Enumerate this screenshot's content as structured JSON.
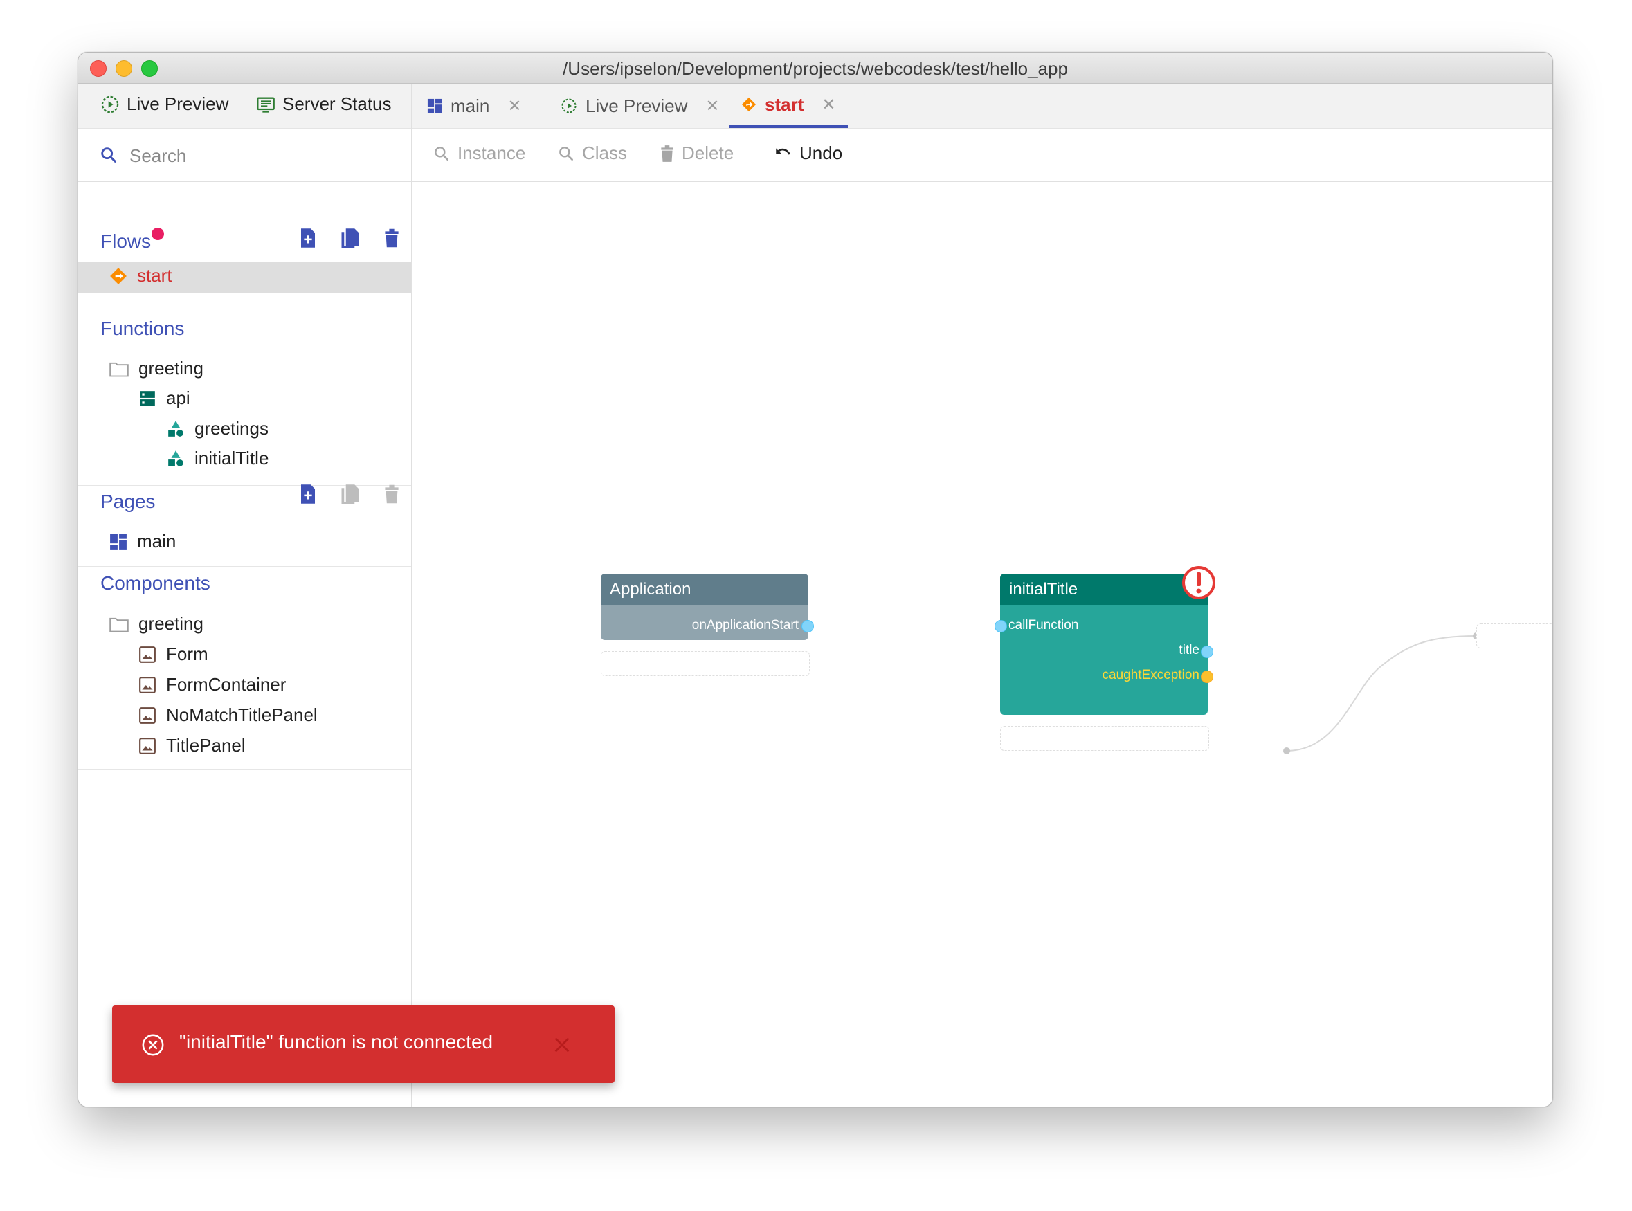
{
  "window": {
    "title": "/Users/ipselon/Development/projects/webcodesk/test/hello_app"
  },
  "sidebar": {
    "tabs": [
      {
        "label": "Live Preview",
        "icon": "live-preview-icon"
      },
      {
        "label": "Server Status",
        "icon": "server-status-icon"
      }
    ],
    "search": {
      "placeholder": "Search",
      "value": ""
    },
    "flows": {
      "title": "Flows",
      "items": [
        {
          "label": "start",
          "icon": "flow-icon",
          "selected": true
        }
      ]
    },
    "functions": {
      "title": "Functions",
      "items": [
        {
          "label": "greeting",
          "icon": "folder-icon"
        },
        {
          "label": "api",
          "icon": "module-icon"
        },
        {
          "label": "greetings",
          "icon": "function-icon"
        },
        {
          "label": "initialTitle",
          "icon": "function-icon"
        }
      ]
    },
    "pages": {
      "title": "Pages",
      "items": [
        {
          "label": "main",
          "icon": "page-icon"
        }
      ]
    },
    "components": {
      "title": "Components",
      "items": [
        {
          "label": "greeting",
          "icon": "folder-icon"
        },
        {
          "label": "Form",
          "icon": "component-icon"
        },
        {
          "label": "FormContainer",
          "icon": "component-icon"
        },
        {
          "label": "NoMatchTitlePanel",
          "icon": "component-icon"
        },
        {
          "label": "TitlePanel",
          "icon": "component-icon"
        }
      ]
    }
  },
  "editor": {
    "tabs": [
      {
        "label": "main",
        "icon": "page-icon",
        "active": false
      },
      {
        "label": "Live Preview",
        "icon": "live-preview-icon",
        "active": false
      },
      {
        "label": "start",
        "icon": "flow-icon",
        "active": true
      }
    ],
    "toolbar": {
      "instance": "Instance",
      "class": "Class",
      "delete": "Delete",
      "undo": "Undo"
    },
    "nodes": {
      "application": {
        "title": "Application",
        "output": "onApplicationStart"
      },
      "initialTitle": {
        "title": "initialTitle",
        "input": "callFunction",
        "outputs": [
          "title",
          "caughtException"
        ],
        "has_error": true
      }
    }
  },
  "toast": {
    "message": "\"initialTitle\" function is not connected"
  },
  "colors": {
    "accent": "#3f51b5",
    "error": "#d32f2f",
    "application_head": "#607d8b",
    "application_body": "#90a4ae",
    "function_head": "#00796b",
    "function_body": "#26a69a",
    "port_blue": "#81d4fa",
    "port_orange": "#fbc02d"
  }
}
